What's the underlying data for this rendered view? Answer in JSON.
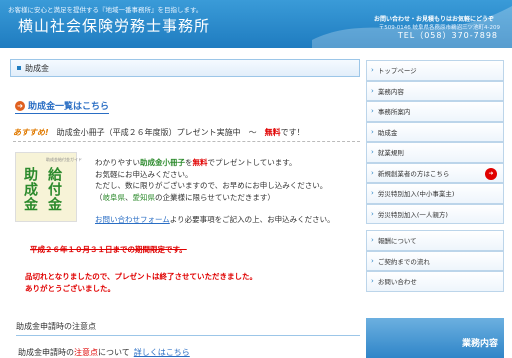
{
  "header": {
    "tagline": "お客様に安心と満足を提供する『地域一番事務所』を目指します。",
    "office_name": "横山社会保険労務士事務所",
    "contact_title": "お問い合わせ・お見積もりはお気軽にどうぞ",
    "address": "〒509-0146 岐阜県各務原市鵜沼三ツ池町4-209",
    "tel": "TEL（058）370-7898"
  },
  "main": {
    "section_title": "助成金",
    "list_link": "助成金一覧はこちら",
    "promo": {
      "recommend": "あすすめ!",
      "text": "助成金小冊子（平成２６年度版）プレゼント実施中　～　",
      "free": "無料",
      "end": "です！"
    },
    "booklet": {
      "title1": "助成金",
      "title2": "給付金",
      "small": "助成金給付金ガイド"
    },
    "desc": {
      "l1_pre": "わかりやすい",
      "l1_booklet": "助成金小冊子",
      "l1_mid": "を",
      "l1_free": "無料",
      "l1_post": "でプレゼントしています。",
      "l2": "お気軽にお申込みください。",
      "l3": "ただし、数に限りがございますので、お早めにお申し込みください。",
      "l4_pre": "（",
      "l4_gifu": "岐阜県",
      "l4_sep": "、",
      "l4_aichi": "愛知県",
      "l4_post": "の企業様に限らせていただきます）"
    },
    "inquiry": {
      "link": "お問い合わせフォーム",
      "text": "より必要事項をご記入の上、お申込みください。"
    },
    "deadline": "平成２６年１０月３１日までの期間限定です。",
    "notice_l1": "品切れとなりましたので、プレゼントは終了させていただきました。",
    "notice_l2": "ありがとうございました。",
    "notes_heading": "助成金申請時の注意点",
    "notes_line": {
      "pre": "助成金申請時の",
      "red": "注意点",
      "mid": "について",
      "link": "詳しくはこちら"
    }
  },
  "sidebar": {
    "items": [
      {
        "label": "トップページ"
      },
      {
        "label": "業務内容"
      },
      {
        "label": "事務所案内"
      },
      {
        "label": "助成金"
      },
      {
        "label": "就業規則"
      },
      {
        "label": "新規創業者の方はこちら"
      },
      {
        "label": "労災特別加入(中小事業主)"
      },
      {
        "label": "労災特別加入(一人親方)"
      },
      {
        "label": "報酬について"
      },
      {
        "label": "ご契約までの流れ"
      },
      {
        "label": "お問い合わせ"
      }
    ],
    "banner_label": "業務内容"
  },
  "colors": {
    "brand": "#1f7cc0",
    "accent_red": "#e00000",
    "green": "#2c8a2c"
  }
}
